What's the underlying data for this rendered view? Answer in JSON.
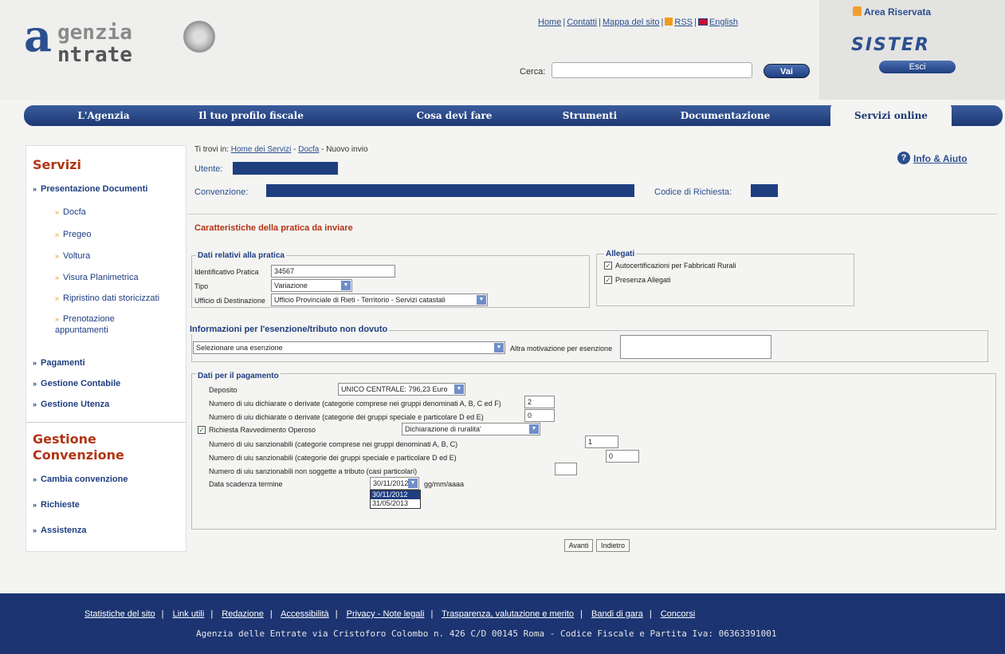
{
  "header": {
    "logo_line1": "genzia",
    "logo_line2": "ntrate",
    "logo_letter": "a",
    "toplinks": [
      "Home",
      "Contatti",
      "Mappa del sito",
      "RSS",
      "English"
    ],
    "search_label": "Cerca:",
    "search_value": "",
    "search_button": "Vai",
    "area_title": "Area Riservata",
    "sister": "SISTER",
    "esci": "Esci"
  },
  "nav": {
    "items": [
      "L'Agenzia",
      "Il tuo profilo fiscale",
      "Cosa devi fare",
      "Strumenti",
      "Documentazione",
      "Servizi online"
    ],
    "active": "Servizi online"
  },
  "sidebar": {
    "servizi_title": "Servizi",
    "presentazione": "Presentazione Documenti",
    "sub_items": [
      "Docfa",
      "Pregeo",
      "Voltura",
      "Visura Planimetrica",
      "Ripristino dati storicizzati",
      "Prenotazione appuntamenti"
    ],
    "pagamenti": "Pagamenti",
    "gestione_contabile": "Gestione Contabile",
    "gestione_utenza": "Gestione Utenza",
    "gestione_convenzione_1": "Gestione",
    "gestione_convenzione_2": "Convenzione",
    "cambia": "Cambia convenzione",
    "richieste": "Richieste",
    "assistenza": "Assistenza"
  },
  "main": {
    "crumb_prefix": "Ti trovi in:",
    "crumb_home": "Home dei Servizi",
    "crumb_docfa": "Docfa",
    "crumb_current": "Nuovo invio",
    "utente_label": "Utente:",
    "convenzione_label": "Convenzione:",
    "codice_label": "Codice di Richiesta:",
    "info_aiuto": "Info & Aiuto",
    "section_title": "Caratteristiche della pratica da inviare",
    "dati_pratica": {
      "legend": "Dati relativi alla pratica",
      "id_label": "Identificativo Pratica",
      "id_value": "34567",
      "tipo_label": "Tipo",
      "tipo_value": "Variazione",
      "ufficio_label": "Ufficio di Destinazione",
      "ufficio_value": "Ufficio Provinciale di Rieti - Territorio - Servizi catastali"
    },
    "allegati": {
      "legend": "Allegati",
      "item1": "Autocertificazioni per Fabbricati Rurali",
      "item2": "Presenza Allegati"
    },
    "esenzione": {
      "legend": "Informazioni per l'esenzione/tributo non dovuto",
      "select_value": "Selezionare una esenzione",
      "altra_label": "Altra motivazione per esenzione"
    },
    "pagamento": {
      "legend": "Dati per il pagamento",
      "deposito_label": "Deposito",
      "deposito_value": "UNICO CENTRALE: 796,23 Euro",
      "uiu1_label": "Numero di uiu dichiarate o derivate (categorie comprese nei gruppi denominati A, B, C ed F)",
      "uiu1_value": "2",
      "uiu2_label": "Numero di uiu dichiarate o derivate (categorie dei gruppi speciale e particolare D ed E)",
      "uiu2_value": "0",
      "ravvedimento_label": "Richiesta Ravvedimento Operoso",
      "ravvedimento_value": "Dichiarazione di ruralita'",
      "sanz1_label": "Numero di uiu sanzionabili (categorie comprese nei gruppi denominati A, B, C)",
      "sanz1_value": "1",
      "sanz2_label": "Numero di uiu sanzionabili (categorie dei gruppi speciale e particolare D ed E)",
      "sanz2_value": "0",
      "sanz3_label": "Numero di uiu sanzionabili non soggette a tributo (casi particolari)",
      "sanz3_value": "",
      "scadenza_label": "Data scadenza termine",
      "scadenza_value": "30/11/2012",
      "scadenza_format": "gg/mm/aaaa",
      "scadenza_options": [
        "30/11/2012",
        "31/05/2013"
      ]
    },
    "avanti": "Avanti",
    "indietro": "Indietro"
  },
  "footer": {
    "links": [
      "Statistiche del sito",
      "Link utili",
      "Redazione",
      "Accessibilità",
      "Privacy - Note legali",
      "Trasparenza, valutazione e merito",
      "Bandi di gara",
      "Concorsi"
    ],
    "address": "Agenzia delle Entrate via Cristoforo Colombo n. 426 C/D 00145 Roma - Codice Fiscale e Partita Iva: 06363391001"
  }
}
